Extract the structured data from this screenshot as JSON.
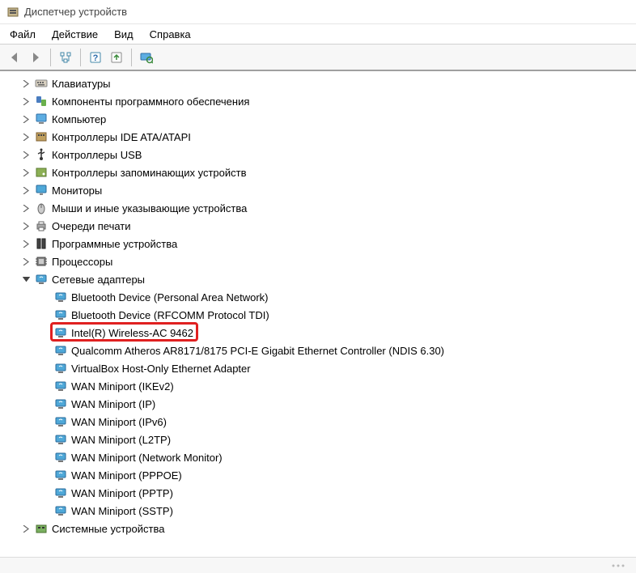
{
  "window": {
    "title": "Диспетчер устройств"
  },
  "menu": {
    "file": "Файл",
    "action": "Действие",
    "view": "Вид",
    "help": "Справка"
  },
  "toolbar": {
    "back": "back",
    "forward": "forward",
    "show_hide": "show-hide",
    "help": "help",
    "refresh": "refresh",
    "scan": "scan-monitor"
  },
  "tree": {
    "collapsed": [
      {
        "label": "Клавиатуры",
        "icon": "keyboard"
      },
      {
        "label": "Компоненты программного обеспечения",
        "icon": "software"
      },
      {
        "label": "Компьютер",
        "icon": "computer"
      },
      {
        "label": "Контроллеры IDE ATA/ATAPI",
        "icon": "ide"
      },
      {
        "label": "Контроллеры USB",
        "icon": "usb"
      },
      {
        "label": "Контроллеры запоминающих устройств",
        "icon": "storage"
      },
      {
        "label": "Мониторы",
        "icon": "monitor"
      },
      {
        "label": "Мыши и иные указывающие устройства",
        "icon": "mouse"
      },
      {
        "label": "Очереди печати",
        "icon": "printer"
      },
      {
        "label": "Программные устройства",
        "icon": "software-dev"
      },
      {
        "label": "Процессоры",
        "icon": "cpu"
      }
    ],
    "network": {
      "label": "Сетевые адаптеры",
      "children": [
        {
          "label": "Bluetooth Device (Personal Area Network)"
        },
        {
          "label": "Bluetooth Device (RFCOMM Protocol TDI)"
        },
        {
          "label": "Intel(R) Wireless-AC 9462",
          "highlighted": true
        },
        {
          "label": "Qualcomm Atheros AR8171/8175 PCI-E Gigabit Ethernet Controller (NDIS 6.30)"
        },
        {
          "label": "VirtualBox Host-Only Ethernet Adapter"
        },
        {
          "label": "WAN Miniport (IKEv2)"
        },
        {
          "label": "WAN Miniport (IP)"
        },
        {
          "label": "WAN Miniport (IPv6)"
        },
        {
          "label": "WAN Miniport (L2TP)"
        },
        {
          "label": "WAN Miniport (Network Monitor)"
        },
        {
          "label": "WAN Miniport (PPPOE)"
        },
        {
          "label": "WAN Miniport (PPTP)"
        },
        {
          "label": "WAN Miniport (SSTP)"
        }
      ]
    },
    "tail": [
      {
        "label": "Системные устройства",
        "icon": "system"
      }
    ]
  }
}
